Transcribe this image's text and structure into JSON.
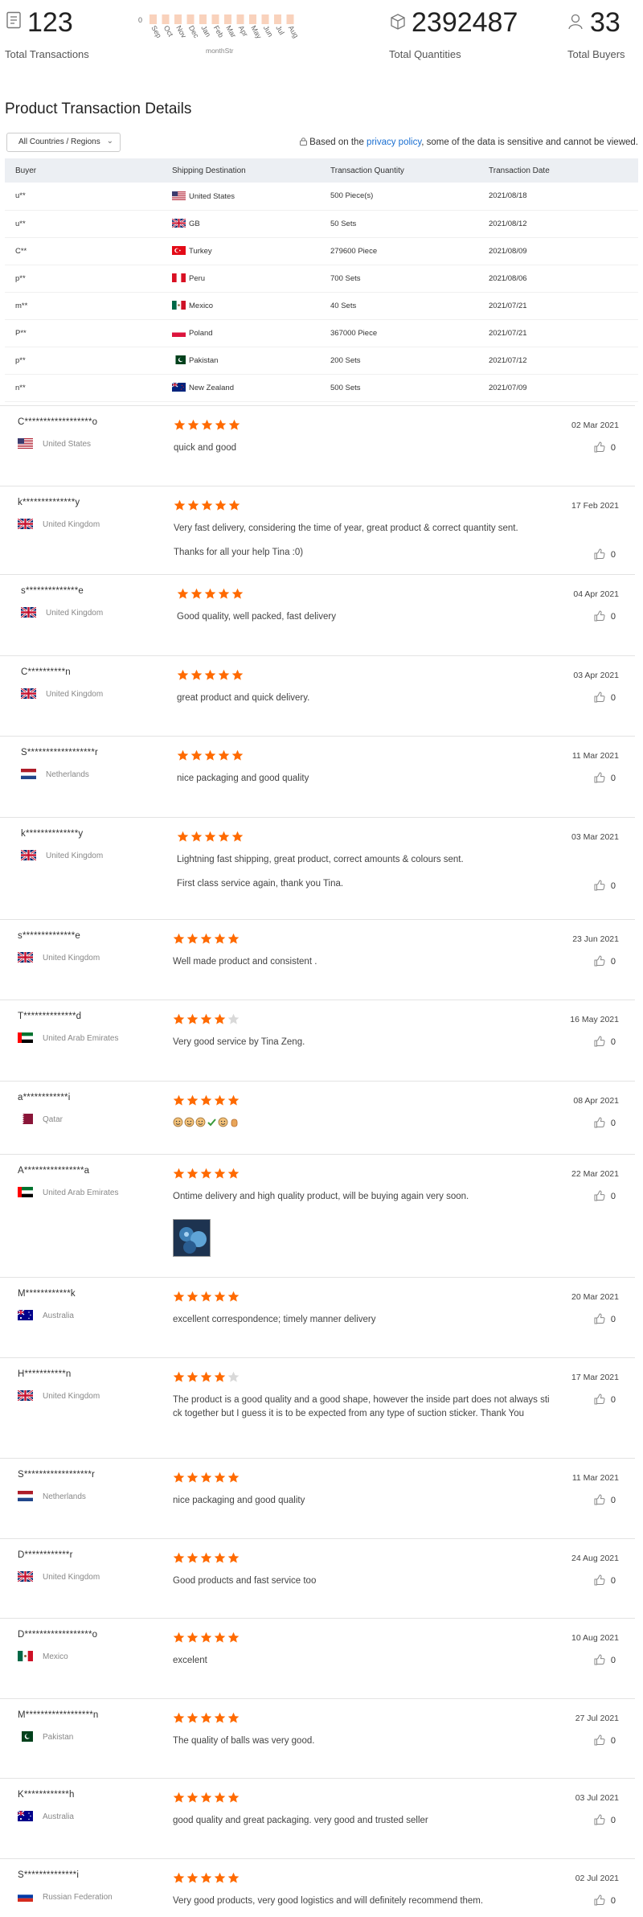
{
  "stats": {
    "total_transactions": {
      "value": "123",
      "label": "Total Transactions",
      "icon": "document-icon"
    },
    "total_quantities": {
      "value": "2392487",
      "label": "Total Quantities",
      "icon": "box-icon"
    },
    "total_buyers": {
      "value": "33",
      "label": "Total Buyers",
      "icon": "user-icon"
    }
  },
  "chart_data": {
    "type": "bar",
    "xlabel": "monthStr",
    "ylabel": "",
    "y_tick_label": "0",
    "categories": [
      "Sep",
      "Oct",
      "Nov",
      "Dec",
      "Jan",
      "Feb",
      "Mar",
      "Apr",
      "May",
      "Jun",
      "Jul",
      "Aug"
    ],
    "values": [
      2,
      2,
      2,
      3,
      3,
      2,
      3,
      2,
      2,
      2,
      3,
      2
    ],
    "color": "#f9d2bc"
  },
  "section_title": "Product Transaction Details",
  "filter": {
    "label": "All Countries / Regions"
  },
  "privacy": {
    "before": "Based on the ",
    "link": "privacy policy",
    "after": ", some of the data is sensitive and cannot be viewed."
  },
  "table": {
    "headers": [
      "Buyer",
      "Shipping Destination",
      "Transaction Quantity",
      "Transaction Date"
    ],
    "rows": [
      {
        "buyer": "u**",
        "flag": "us",
        "destination": "United States",
        "quantity": "500 Piece(s)",
        "date": "2021/08/18"
      },
      {
        "buyer": "u**",
        "flag": "gb",
        "destination": "GB",
        "quantity": "50 Sets",
        "date": "2021/08/12"
      },
      {
        "buyer": "C**",
        "flag": "tr",
        "destination": "Turkey",
        "quantity": "279600 Piece",
        "date": "2021/08/09"
      },
      {
        "buyer": "p**",
        "flag": "pe",
        "destination": "Peru",
        "quantity": "700 Sets",
        "date": "2021/08/06"
      },
      {
        "buyer": "m**",
        "flag": "mx",
        "destination": "Mexico",
        "quantity": "40 Sets",
        "date": "2021/07/21"
      },
      {
        "buyer": "P**",
        "flag": "pl",
        "destination": "Poland",
        "quantity": "367000 Piece",
        "date": "2021/07/21"
      },
      {
        "buyer": "p**",
        "flag": "pk",
        "destination": "Pakistan",
        "quantity": "200 Sets",
        "date": "2021/07/12"
      },
      {
        "buyer": "n**",
        "flag": "nz",
        "destination": "New Zealand",
        "quantity": "500 Sets",
        "date": "2021/07/09"
      }
    ]
  },
  "reviews": [
    {
      "name": "C******************o",
      "flag": "us",
      "country": "United States",
      "rating": 5,
      "text": [
        "quick and good"
      ],
      "date": "02 Mar 2021",
      "likes": "0"
    },
    {
      "name": "k**************y",
      "flag": "gb",
      "country": "United Kingdom",
      "rating": 5,
      "text": [
        "Very fast delivery, considering the time of year, great product & correct quantity sent.",
        "Thanks for all your help Tina :0)"
      ],
      "date": "17 Feb 2021",
      "likes": "0"
    },
    {
      "name": "s**************e",
      "flag": "gb",
      "country": "United Kingdom",
      "rating": 5,
      "text": [
        "Good quality, well packed, fast delivery"
      ],
      "date": "04 Apr 2021",
      "likes": "0"
    },
    {
      "name": "C**********n",
      "flag": "gb",
      "country": "United Kingdom",
      "rating": 5,
      "text": [
        "great product and quick delivery."
      ],
      "date": "03 Apr 2021",
      "likes": "0"
    },
    {
      "name": "S******************r",
      "flag": "nl",
      "country": "Netherlands",
      "rating": 5,
      "text": [
        "nice packaging and good quality"
      ],
      "date": "11 Mar 2021",
      "likes": "0"
    },
    {
      "name": "k**************y",
      "flag": "gb",
      "country": "United Kingdom",
      "rating": 5,
      "text": [
        "Lightning fast shipping, great product, correct amounts & colours sent.",
        "First class service again, thank you Tina."
      ],
      "date": "03 Mar 2021",
      "likes": "0"
    },
    {
      "name": "s**************e",
      "flag": "gb",
      "country": "United Kingdom",
      "rating": 5,
      "text": [
        "Well made product and consistent ."
      ],
      "date": "23 Jun 2021",
      "likes": "0"
    },
    {
      "name": "T**************d",
      "flag": "ae",
      "country": "United Arab Emirates",
      "rating": 4,
      "text": [
        "Very good service by Tina Zeng."
      ],
      "date": "16 May 2021",
      "likes": "0"
    },
    {
      "name": "a************i",
      "flag": "qa",
      "country": "Qatar",
      "rating": 5,
      "text": [
        ""
      ],
      "emoji": [
        "face",
        "face",
        "face",
        "check",
        "face",
        "hand"
      ],
      "date": "08 Apr 2021",
      "likes": "0"
    },
    {
      "name": "A****************a",
      "flag": "ae",
      "country": "United Arab Emirates",
      "rating": 5,
      "text": [
        "Ontime delivery and high quality product, will be buying again very soon."
      ],
      "photo": true,
      "date": "22 Mar 2021",
      "likes": "0"
    },
    {
      "name": "M************k",
      "flag": "au",
      "country": "Australia",
      "rating": 5,
      "text": [
        "excellent correspondence;  timely manner delivery"
      ],
      "date": "20 Mar 2021",
      "likes": "0"
    },
    {
      "name": "H***********n",
      "flag": "gb",
      "country": "United Kingdom",
      "rating": 4,
      "text": [
        "The product is a good quality and a good shape, however the inside part does not always sti ck together but I guess it is to be expected from any type of suction sticker. Thank You"
      ],
      "date": "17 Mar 2021",
      "likes": "0"
    },
    {
      "name": "S******************r",
      "flag": "nl",
      "country": "Netherlands",
      "rating": 5,
      "text": [
        "nice packaging and good quality"
      ],
      "date": "11 Mar 2021",
      "likes": "0"
    },
    {
      "name": "D************r",
      "flag": "gb",
      "country": "United Kingdom",
      "rating": 5,
      "text": [
        "Good products and fast service too"
      ],
      "date": "24 Aug 2021",
      "likes": "0"
    },
    {
      "name": "D******************o",
      "flag": "mx",
      "country": "Mexico",
      "rating": 5,
      "text": [
        "excelent"
      ],
      "date": "10 Aug 2021",
      "likes": "0"
    },
    {
      "name": "M******************n",
      "flag": "pk",
      "country": "Pakistan",
      "rating": 5,
      "text": [
        "The quality of balls was very good."
      ],
      "date": "27 Jul 2021",
      "likes": "0"
    },
    {
      "name": "K************h",
      "flag": "au",
      "country": "Australia",
      "rating": 5,
      "text": [
        "good quality and great packaging. very good and trusted seller"
      ],
      "date": "03 Jul 2021",
      "likes": "0"
    },
    {
      "name": "S**************i",
      "flag": "ru",
      "country": "Russian Federation",
      "rating": 5,
      "text": [
        "Very good products, very good logistics and will definitely recommend them."
      ],
      "date": "02 Jul 2021",
      "likes": "0"
    }
  ]
}
